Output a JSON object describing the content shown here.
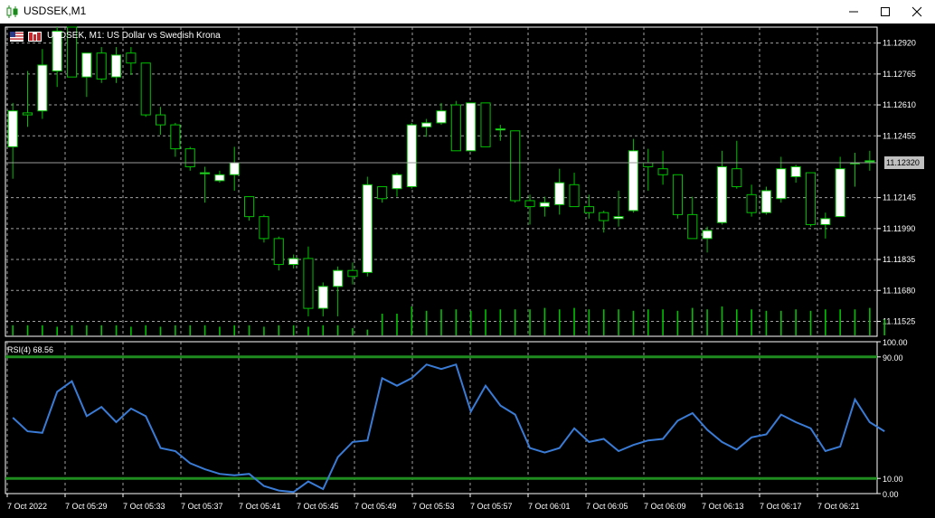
{
  "window": {
    "title": "USDSEK,M1",
    "minimize_glyph": "—",
    "maximize_glyph": "☐",
    "close_glyph": "✕"
  },
  "chart": {
    "info": "USDSEK, M1:  US Dollar vs Swedish Krona",
    "current_price": "11.12320",
    "price_levels": [
      "11.12920",
      "11.12765",
      "11.12610",
      "11.12455",
      "11.12145",
      "11.11990",
      "11.11835",
      "11.11680",
      "11.11525"
    ],
    "time_labels": [
      "7 Oct 2022",
      "7 Oct 05:29",
      "7 Oct 05:33",
      "7 Oct 05:37",
      "7 Oct 05:41",
      "7 Oct 05:45",
      "7 Oct 05:49",
      "7 Oct 05:53",
      "7 Oct 05:57",
      "7 Oct 06:01",
      "7 Oct 06:05",
      "7 Oct 06:09",
      "7 Oct 06:13",
      "7 Oct 06:17",
      "7 Oct 06:21"
    ],
    "colors": {
      "background": "#000000",
      "grid": "#c8c8c8",
      "bull_body": "#ffffff",
      "bear_body": "#000000",
      "wick": "#00c000",
      "rsi_line": "#3a7bd5",
      "rsi_level": "#1e8c1e",
      "volume": "#00c000"
    }
  },
  "rsi": {
    "label": "RSI(4) 68.56",
    "scale": [
      "100.00",
      "90.00",
      "10.00",
      "0.00"
    ],
    "levels": [
      90,
      10
    ],
    "values": [
      50,
      41,
      40,
      67,
      74,
      51,
      57,
      47,
      56,
      51,
      30,
      28,
      20,
      16,
      13,
      12,
      13,
      5,
      2,
      1,
      8,
      3,
      24,
      34,
      35,
      76,
      71,
      76,
      85,
      82,
      85,
      54,
      71,
      58,
      52,
      30,
      27,
      30,
      43,
      34,
      36,
      28,
      32,
      35,
      36,
      48,
      53,
      42,
      34,
      29,
      37,
      39,
      52,
      47,
      43,
      28,
      31,
      62,
      47,
      41
    ]
  },
  "chart_data": {
    "type": "candlestick",
    "symbol": "USDSEK",
    "timeframe": "M1",
    "ylim": [
      11.1145,
      11.13
    ],
    "candles": [
      {
        "o": 11.124,
        "h": 11.1262,
        "l": 11.1224,
        "c": 11.1258
      },
      {
        "o": 11.1257,
        "h": 11.1278,
        "l": 11.125,
        "c": 11.1256
      },
      {
        "o": 11.1258,
        "h": 11.1289,
        "l": 11.1254,
        "c": 11.1281
      },
      {
        "o": 11.1278,
        "h": 11.13,
        "l": 11.127,
        "c": 11.1298
      },
      {
        "o": 11.13,
        "h": 11.13,
        "l": 11.1275,
        "c": 11.1275
      },
      {
        "o": 11.1275,
        "h": 11.1287,
        "l": 11.1265,
        "c": 11.1287
      },
      {
        "o": 11.1287,
        "h": 11.129,
        "l": 11.1272,
        "c": 11.1274
      },
      {
        "o": 11.1275,
        "h": 11.129,
        "l": 11.1272,
        "c": 11.1286
      },
      {
        "o": 11.1287,
        "h": 11.129,
        "l": 11.1276,
        "c": 11.1282
      },
      {
        "o": 11.1282,
        "h": 11.1282,
        "l": 11.1255,
        "c": 11.1256
      },
      {
        "o": 11.1256,
        "h": 11.126,
        "l": 11.1246,
        "c": 11.1251
      },
      {
        "o": 11.1251,
        "h": 11.1252,
        "l": 11.1235,
        "c": 11.1239
      },
      {
        "o": 11.1239,
        "h": 11.124,
        "l": 11.1228,
        "c": 11.123
      },
      {
        "o": 11.1227,
        "h": 11.123,
        "l": 11.1212,
        "c": 11.1227
      },
      {
        "o": 11.1223,
        "h": 11.1228,
        "l": 11.1222,
        "c": 11.1226
      },
      {
        "o": 11.1226,
        "h": 11.124,
        "l": 11.1218,
        "c": 11.1232
      },
      {
        "o": 11.1215,
        "h": 11.1215,
        "l": 11.1203,
        "c": 11.1205
      },
      {
        "o": 11.1205,
        "h": 11.1206,
        "l": 11.1192,
        "c": 11.1194
      },
      {
        "o": 11.1194,
        "h": 11.1195,
        "l": 11.1178,
        "c": 11.1181
      },
      {
        "o": 11.1181,
        "h": 11.1186,
        "l": 11.1179,
        "c": 11.1184
      },
      {
        "o": 11.1184,
        "h": 11.119,
        "l": 11.1155,
        "c": 11.1159
      },
      {
        "o": 11.1159,
        "h": 11.1172,
        "l": 11.1155,
        "c": 11.117
      },
      {
        "o": 11.117,
        "h": 11.118,
        "l": 11.1155,
        "c": 11.1178
      },
      {
        "o": 11.1178,
        "h": 11.1182,
        "l": 11.1171,
        "c": 11.1175
      },
      {
        "o": 11.1177,
        "h": 11.1225,
        "l": 11.1175,
        "c": 11.1221
      },
      {
        "o": 11.122,
        "h": 11.122,
        "l": 11.1212,
        "c": 11.1214
      },
      {
        "o": 11.1219,
        "h": 11.1227,
        "l": 11.1215,
        "c": 11.1226
      },
      {
        "o": 11.122,
        "h": 11.1252,
        "l": 11.1219,
        "c": 11.1251
      },
      {
        "o": 11.125,
        "h": 11.1254,
        "l": 11.1245,
        "c": 11.1252
      },
      {
        "o": 11.1252,
        "h": 11.1262,
        "l": 11.1251,
        "c": 11.1258
      },
      {
        "o": 11.1261,
        "h": 11.1263,
        "l": 11.1238,
        "c": 11.1238
      },
      {
        "o": 11.1238,
        "h": 11.1262,
        "l": 11.1238,
        "c": 11.1262
      },
      {
        "o": 11.1262,
        "h": 11.1262,
        "l": 11.124,
        "c": 11.124
      },
      {
        "o": 11.1249,
        "h": 11.1251,
        "l": 11.1243,
        "c": 11.1249
      },
      {
        "o": 11.1248,
        "h": 11.1248,
        "l": 11.1212,
        "c": 11.1213
      },
      {
        "o": 11.1213,
        "h": 11.1216,
        "l": 11.1201,
        "c": 11.121
      },
      {
        "o": 11.121,
        "h": 11.1215,
        "l": 11.1205,
        "c": 11.1212
      },
      {
        "o": 11.1211,
        "h": 11.1229,
        "l": 11.1206,
        "c": 11.1222
      },
      {
        "o": 11.1221,
        "h": 11.1227,
        "l": 11.121,
        "c": 11.121
      },
      {
        "o": 11.121,
        "h": 11.1216,
        "l": 11.1204,
        "c": 11.1207
      },
      {
        "o": 11.1207,
        "h": 11.1208,
        "l": 11.1197,
        "c": 11.1203
      },
      {
        "o": 11.1204,
        "h": 11.1218,
        "l": 11.12,
        "c": 11.1205
      },
      {
        "o": 11.1208,
        "h": 11.1244,
        "l": 11.1207,
        "c": 11.1238
      },
      {
        "o": 11.1232,
        "h": 11.1239,
        "l": 11.1218,
        "c": 11.123
      },
      {
        "o": 11.1229,
        "h": 11.1238,
        "l": 11.1221,
        "c": 11.1226
      },
      {
        "o": 11.1226,
        "h": 11.1226,
        "l": 11.1204,
        "c": 11.1206
      },
      {
        "o": 11.1206,
        "h": 11.1215,
        "l": 11.1194,
        "c": 11.1194
      },
      {
        "o": 11.1194,
        "h": 11.12,
        "l": 11.1187,
        "c": 11.1198
      },
      {
        "o": 11.1202,
        "h": 11.1238,
        "l": 11.1201,
        "c": 11.123
      },
      {
        "o": 11.1229,
        "h": 11.1243,
        "l": 11.1219,
        "c": 11.122
      },
      {
        "o": 11.1216,
        "h": 11.1221,
        "l": 11.1205,
        "c": 11.1207
      },
      {
        "o": 11.1207,
        "h": 11.122,
        "l": 11.1206,
        "c": 11.1218
      },
      {
        "o": 11.1214,
        "h": 11.1235,
        "l": 11.1212,
        "c": 11.1229
      },
      {
        "o": 11.1225,
        "h": 11.1231,
        "l": 11.1222,
        "c": 11.123
      },
      {
        "o": 11.1227,
        "h": 11.1227,
        "l": 11.12,
        "c": 11.1201
      },
      {
        "o": 11.1201,
        "h": 11.1207,
        "l": 11.1194,
        "c": 11.1204
      },
      {
        "o": 11.1205,
        "h": 11.1235,
        "l": 11.1205,
        "c": 11.1229
      },
      {
        "o": 11.1232,
        "h": 11.1237,
        "l": 11.122,
        "c": 11.1232
      },
      {
        "o": 11.1233,
        "h": 11.1238,
        "l": 11.1228,
        "c": 11.1233
      }
    ],
    "volume": [
      7,
      7,
      7,
      6,
      7,
      7,
      7,
      7,
      6,
      7,
      6,
      7,
      7,
      7,
      6,
      7,
      7,
      6,
      7,
      7,
      6,
      7,
      7,
      5,
      4,
      15,
      15,
      20,
      17,
      18,
      18,
      17,
      18,
      18,
      18,
      18,
      19,
      18,
      19,
      18,
      18,
      18,
      17,
      18,
      18,
      17,
      19,
      18,
      20,
      18,
      18,
      17,
      17,
      18,
      17,
      18,
      18,
      18,
      19,
      11
    ]
  }
}
